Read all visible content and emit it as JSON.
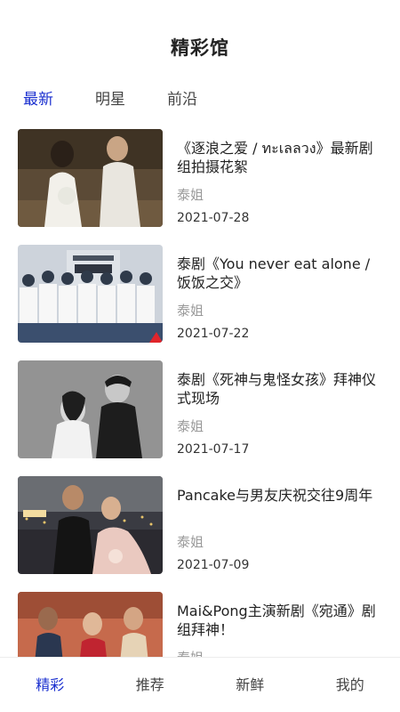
{
  "header": {
    "title": "精彩馆"
  },
  "tabs": [
    {
      "label": "最新",
      "active": true
    },
    {
      "label": "明星",
      "active": false
    },
    {
      "label": "前沿",
      "active": false
    }
  ],
  "articles": [
    {
      "title": "《逐浪之爱 / ทะเลลวง》最新剧组拍摄花絮",
      "author": "泰姐",
      "date": "2021-07-28"
    },
    {
      "title": "泰剧《You never eat alone / 饭饭之交》",
      "author": "泰姐",
      "date": "2021-07-22"
    },
    {
      "title": "泰剧《死神与鬼怪女孩》拜神仪式现场",
      "author": "泰姐",
      "date": "2021-07-17"
    },
    {
      "title": "Pancake与男友庆祝交往9周年",
      "author": "泰姐",
      "date": "2021-07-09"
    },
    {
      "title": "Mai&Pong主演新剧《宛通》剧组拜神！",
      "author": "泰姐",
      "date": ""
    }
  ],
  "bottom_nav": [
    {
      "label": "精彩",
      "active": true
    },
    {
      "label": "推荐",
      "active": false
    },
    {
      "label": "新鲜",
      "active": false
    },
    {
      "label": "我的",
      "active": false
    }
  ],
  "colors": {
    "accent": "#1a2fcf",
    "muted": "#999999"
  }
}
